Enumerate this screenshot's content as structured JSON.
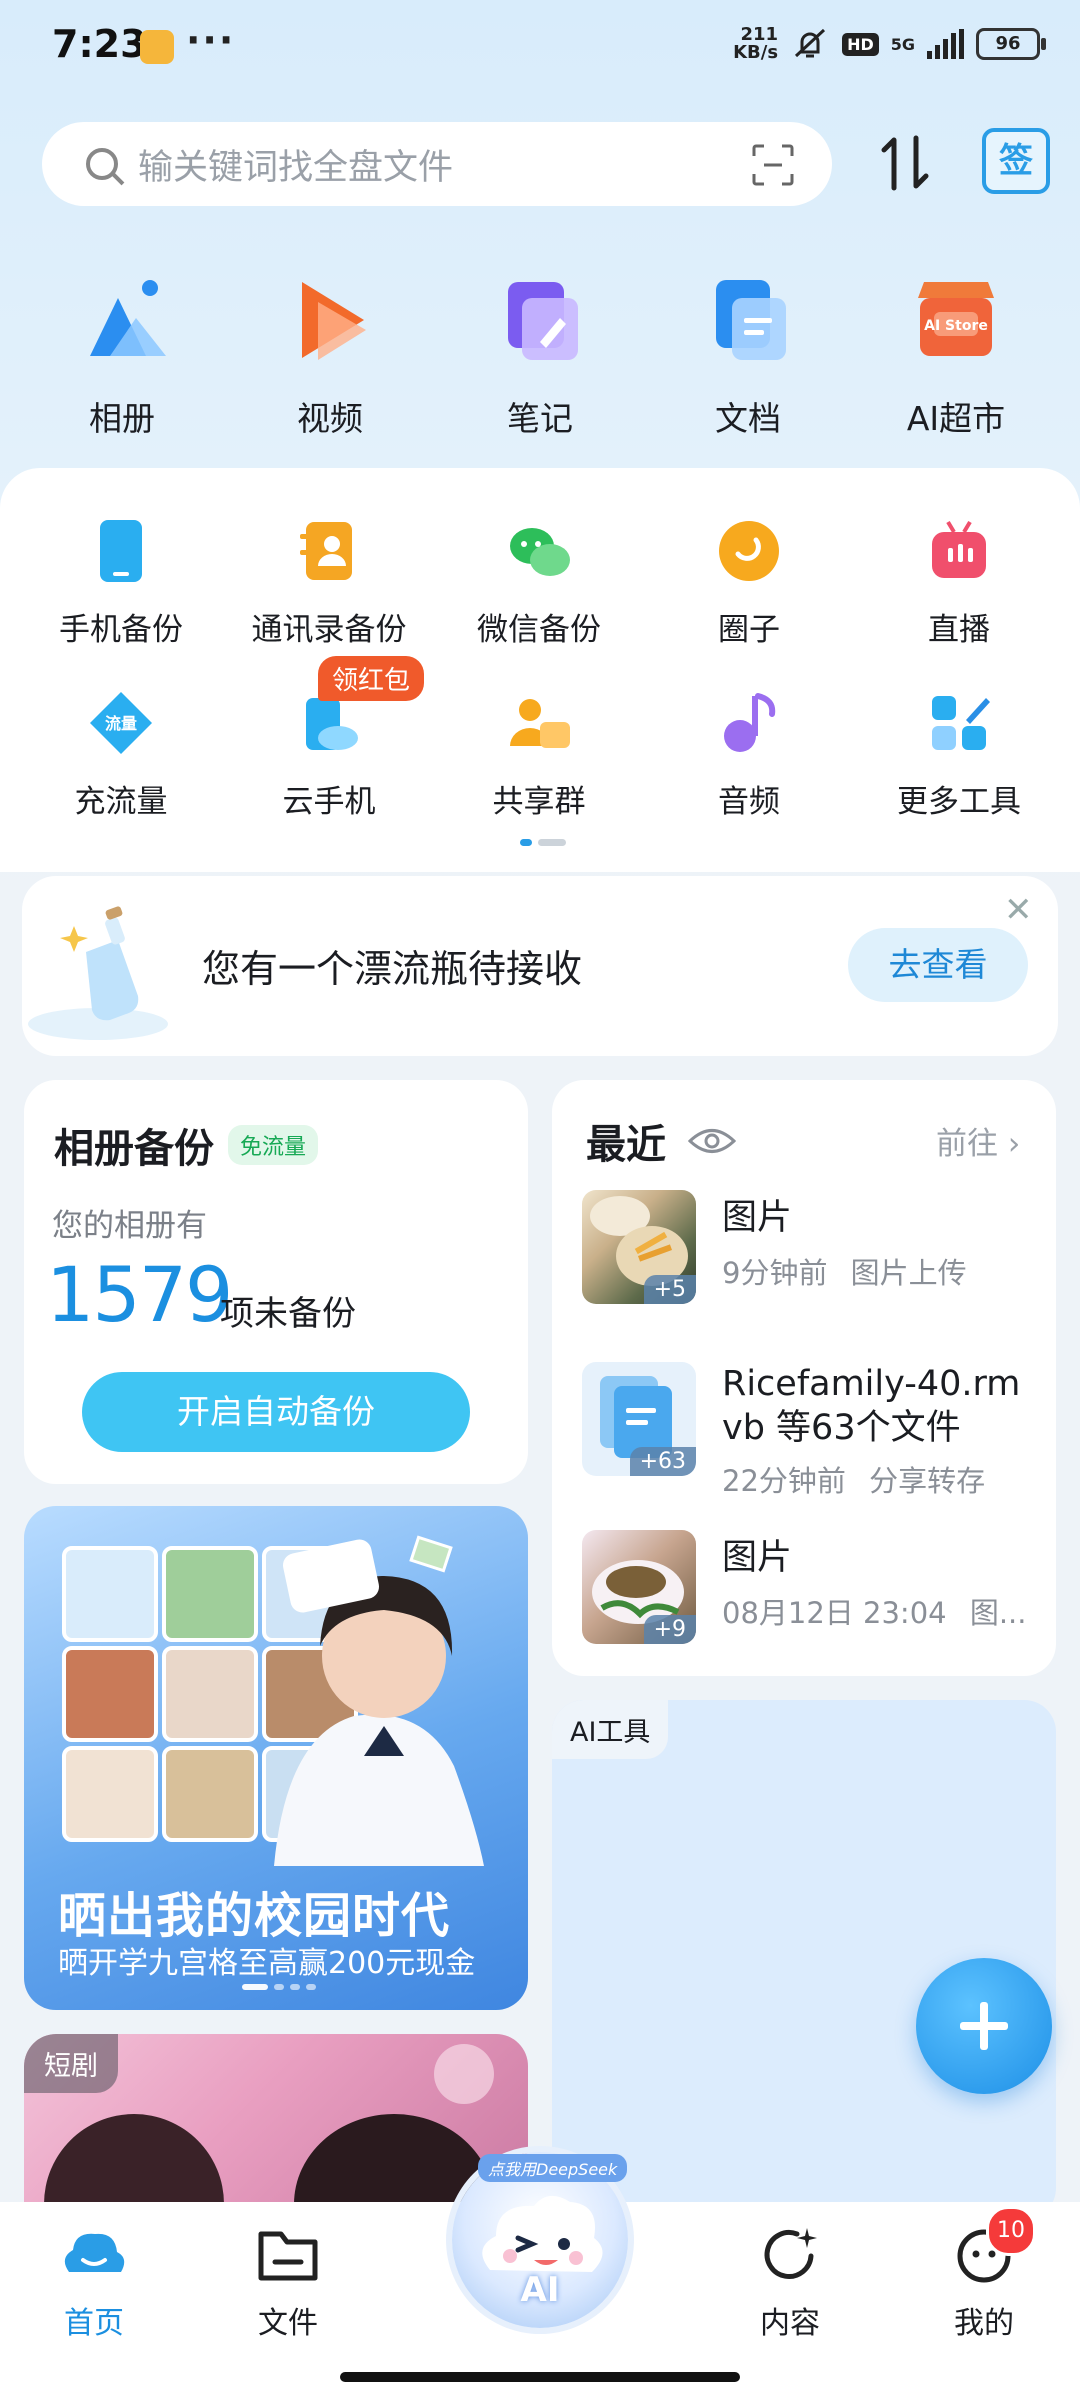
{
  "status_bar": {
    "time": "7:23",
    "net_speed_value": "211",
    "net_speed_unit": "KB/s",
    "hd": "HD",
    "network": "5G",
    "battery": "96"
  },
  "search": {
    "placeholder": "输关键词找全盘文件"
  },
  "sign_badge": "签",
  "main_shortcuts": [
    "相册",
    "视频",
    "笔记",
    "文档",
    "AI超市"
  ],
  "ai_store_icon_text": "AI Store",
  "tools": [
    "手机备份",
    "通讯录备份",
    "微信备份",
    "圈子",
    "直播",
    "充流量",
    "云手机",
    "共享群",
    "音频",
    "更多工具"
  ],
  "traffic_icon_text": "流量",
  "red_packet_tag": "领红包",
  "bottle_banner": {
    "text": "您有一个漂流瓶待接收",
    "button": "去查看"
  },
  "album_backup": {
    "title": "相册备份",
    "tag": "免流量",
    "subtitle": "您的相册有",
    "count": "1579",
    "count_label": "项未备份",
    "button": "开启自动备份"
  },
  "recent": {
    "title": "最近",
    "more": "前往",
    "items": [
      {
        "title": "图片",
        "time": "9分钟前",
        "source": "图片上传",
        "count": "+5"
      },
      {
        "title": "Ricefamily-40.rmvb 等63个文件",
        "time": "22分钟前",
        "source": "分享转存",
        "count": "+63"
      },
      {
        "title": "图片",
        "time": "08月12日 23:04",
        "source": "图...",
        "count": "+9"
      }
    ]
  },
  "promo": {
    "title": "晒出我的校园时代",
    "subtitle": "晒开学九宫格至高赢200元现金"
  },
  "ai_tools_tag": "AI工具",
  "drama_tag": "短剧",
  "bottom_nav": {
    "home": "首页",
    "files": "文件",
    "ai": "AI",
    "ai_tag": "点我用DeepSeek",
    "content": "内容",
    "mine": "我的",
    "mine_badge": "10"
  },
  "colors": {
    "accent": "#1b8fe0",
    "button": "#3fc5f3",
    "badge": "#f53a3a",
    "tag_orange": "#f05a2b"
  }
}
